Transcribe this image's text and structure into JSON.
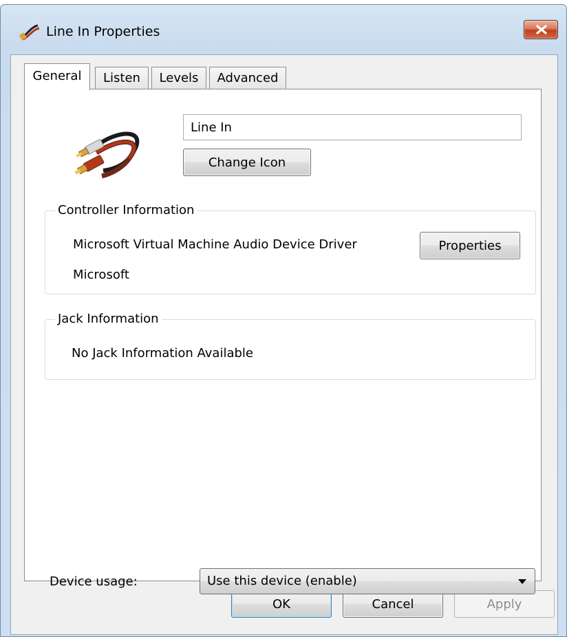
{
  "window": {
    "title": "Line In Properties"
  },
  "tabs": [
    {
      "label": "General",
      "active": true
    },
    {
      "label": "Listen",
      "active": false
    },
    {
      "label": "Levels",
      "active": false
    },
    {
      "label": "Advanced",
      "active": false
    }
  ],
  "general": {
    "device_name": "Line In",
    "change_icon_label": "Change Icon",
    "controller": {
      "title": "Controller Information",
      "driver": "Microsoft Virtual Machine Audio Device Driver",
      "manufacturer": "Microsoft",
      "properties_label": "Properties"
    },
    "jack": {
      "title": "Jack Information",
      "info": "No Jack Information Available"
    },
    "device_usage": {
      "label": "Device usage:",
      "value": "Use this device (enable)"
    }
  },
  "buttons": {
    "ok": "OK",
    "cancel": "Cancel",
    "apply": "Apply"
  },
  "colors": {
    "close_button": "#c0401e",
    "default_button_border": "#3c7fb1",
    "cable_red": "#b5371c",
    "connector_gold": "#d9a23b"
  },
  "icons": {
    "title": "audio-cable-icon",
    "device": "rca-cable-icon",
    "close": "close-icon",
    "dropdown": "dropdown-arrow-icon"
  }
}
